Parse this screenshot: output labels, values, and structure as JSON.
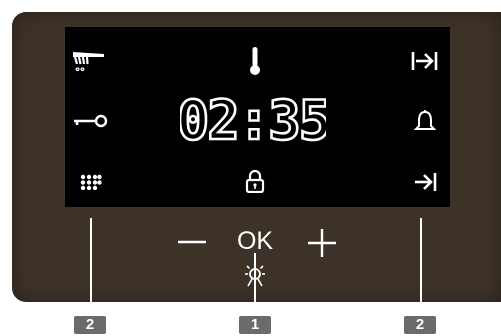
{
  "display": {
    "time": "02:35"
  },
  "controls": {
    "minus_icon": "minus-icon",
    "ok_label": "OK",
    "plus_icon": "plus-icon"
  },
  "icons": {
    "top_left": "cleaning-brush-icon",
    "top_center": "thermometer-icon",
    "top_right": "end-time-icon",
    "middle_left": "key-lock-icon",
    "middle_right": "bell-icon",
    "bottom_left": "menu-dots-icon",
    "bottom_center": "padlock-icon",
    "bottom_right": "duration-icon",
    "lamp": "lamp-icon"
  },
  "callouts": {
    "left": "2",
    "center": "1",
    "right": "2"
  },
  "colors": {
    "panel": "#3d3228",
    "screen": "#000000",
    "foreground": "#ffffff",
    "callout": "#6b6b6b"
  }
}
